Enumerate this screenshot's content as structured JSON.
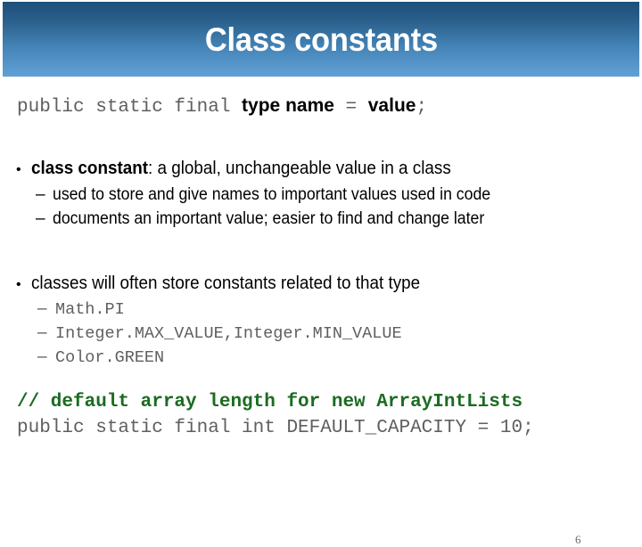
{
  "slide": {
    "title": "Class constants",
    "page_number": "6",
    "colors": {
      "banner_top": "#1c4f79",
      "banner_bottom": "#5fa0d4",
      "title_text": "#ffffff",
      "code_gray": "#5f5f5f",
      "comment_green": "#1b6b21",
      "body_text": "#000000"
    }
  },
  "syntax": {
    "modifiers": "public static final ",
    "type_keyword": "type",
    "space1": " ",
    "name_keyword": "name",
    "equals": " = ",
    "value_keyword": "value",
    "semicolon": ";"
  },
  "bullets": [
    {
      "marker": "•",
      "bold_lead": "class constant",
      "rest": ": a global, unchangeable value in a class",
      "subbullets": [
        {
          "marker": "–",
          "text": "used to store and give names to important values used in code"
        },
        {
          "marker": "–",
          "text": "documents an important value;  easier to find and change later"
        }
      ]
    },
    {
      "marker": "•",
      "bold_lead": "",
      "rest": "classes will often store constants related to that type",
      "subbullets": [
        {
          "marker": "–",
          "text": "Math.PI"
        },
        {
          "marker": "–",
          "text": "Integer.MAX_VALUE,Integer.MIN_VALUE"
        },
        {
          "marker": "–",
          "text": "Color.GREEN"
        }
      ]
    }
  ],
  "code_block": {
    "comment": "// default array length for new ArrayIntLists",
    "declaration": "public static final int DEFAULT_CAPACITY = 10;"
  }
}
